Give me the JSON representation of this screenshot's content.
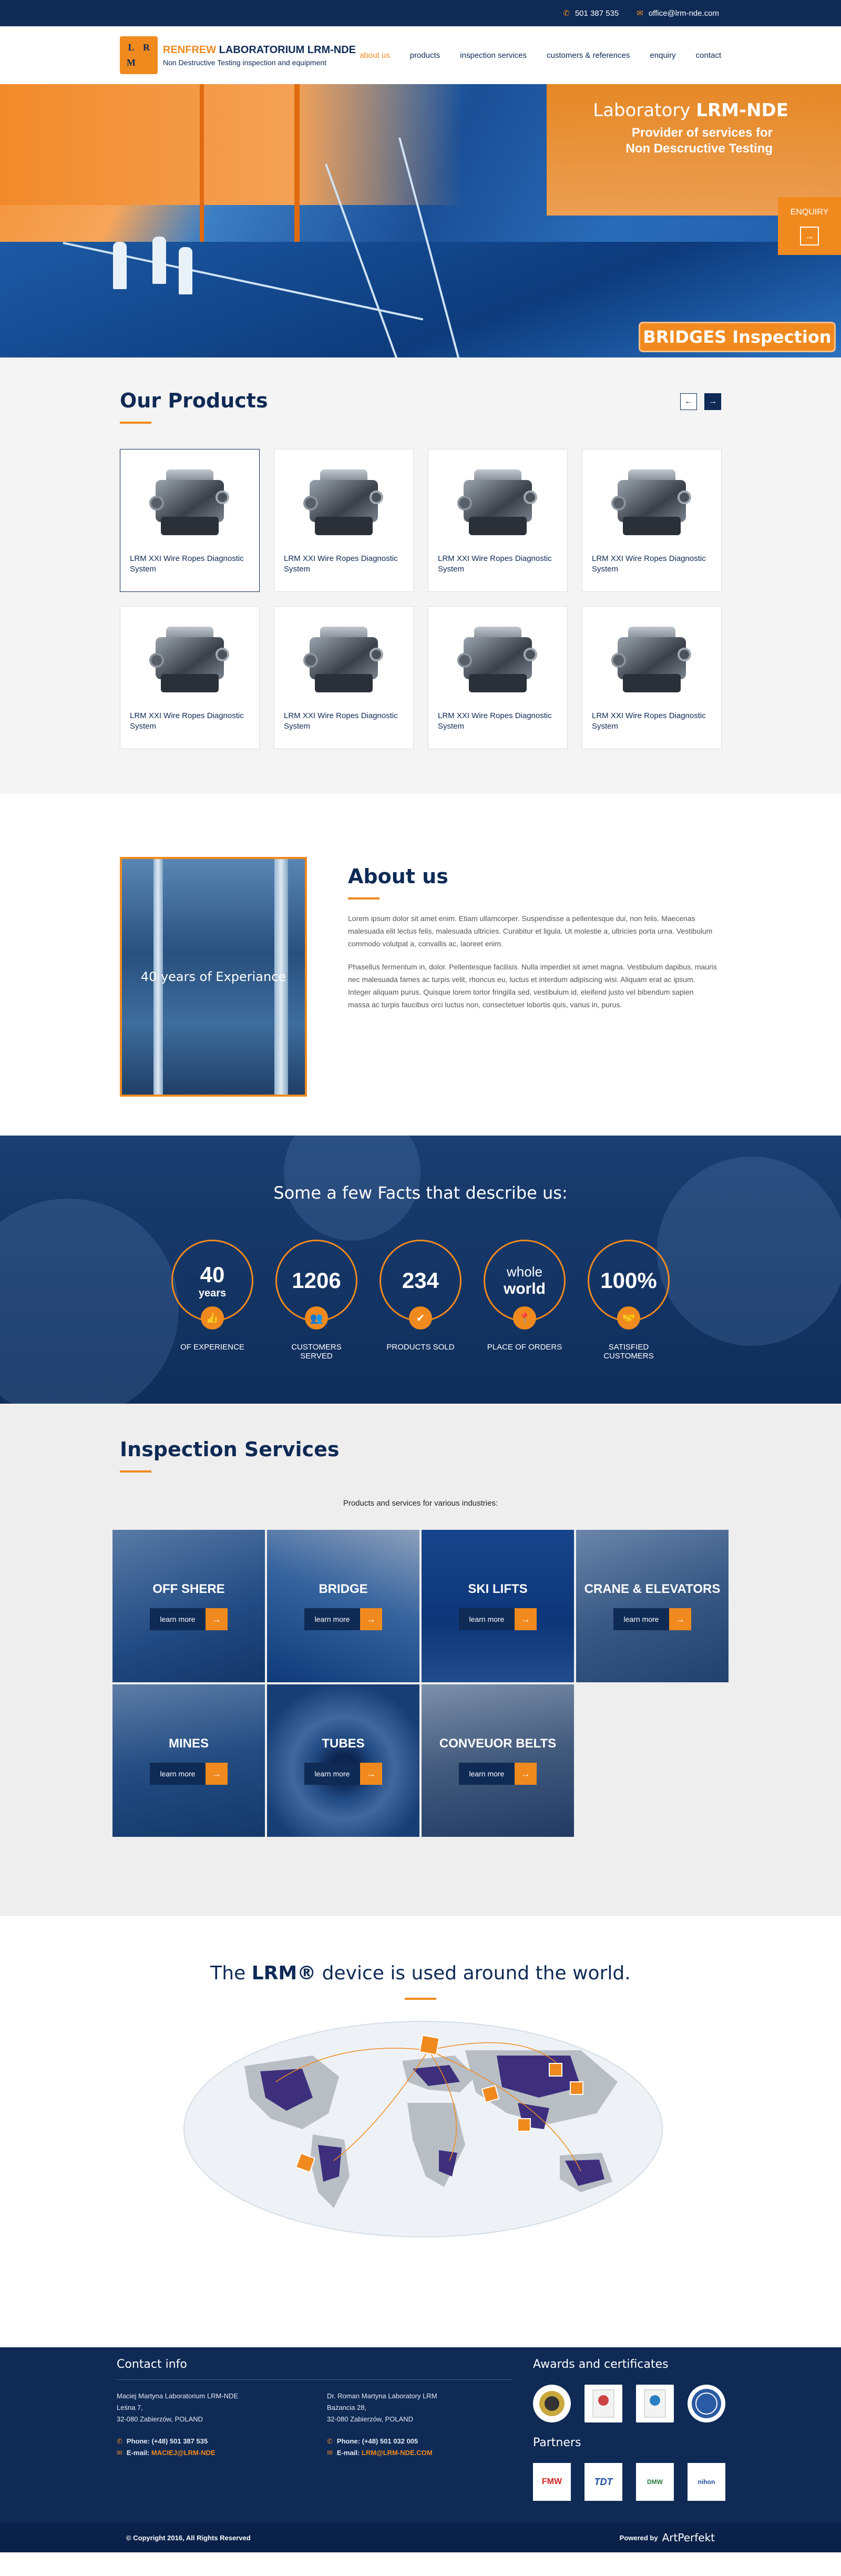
{
  "topbar": {
    "phone": "501 387 535",
    "email": "office@lrm-nde.com"
  },
  "header": {
    "logo_letters": [
      "L",
      "R",
      "M",
      ""
    ],
    "brand_orange": "RENFREW",
    "brand_dark": "LABORATORIUM LRM-NDE",
    "tagline": "Non Destructive Testing inspection and equipment",
    "nav": [
      "about us",
      "products",
      "inspection services",
      "customers & references",
      "enquiry",
      "contact"
    ],
    "active_nav": "about us"
  },
  "hero": {
    "title_prefix": "Laboratory",
    "title_bold": "LRM-NDE",
    "subtitle_line1": "Provider of services for",
    "subtitle_line2": "Non Descructive Testing",
    "enquiry_label": "ENQUIRY",
    "badge": "BRIDGES Inspection"
  },
  "products": {
    "title": "Our Products",
    "items": [
      "LRM XXI Wire Ropes Diagnostic System",
      "LRM XXI Wire Ropes Diagnostic System",
      "LRM XXI Wire Ropes Diagnostic System",
      "LRM XXI Wire Ropes Diagnostic System",
      "LRM XXI Wire Ropes Diagnostic System",
      "LRM XXI Wire Ropes Diagnostic System",
      "LRM XXI Wire Ropes Diagnostic System",
      "LRM XXI Wire Ropes Diagnostic System"
    ]
  },
  "about": {
    "title": "About us",
    "photo_caption": "40 years of Experiance",
    "p1": "Lorem ipsum dolor sit amet enim. Etiam ullamcorper. Suspendisse a pellentesque dui, non felis. Maecenas malesuada elit lectus felis, malesuada ultricies. Curabitur et ligula. Ut molestie a, ultricies porta urna. Vestibulum commodo volutpat a, convallis ac, laoreet enim.",
    "p2": "Phasellus fermentum in, dolor. Pellentesque facilisis. Nulla imperdiet sit amet magna. Vestibulum dapibus, mauris nec malesuada fames ac turpis velit, rhoncus eu, luctus et interdum adipiscing wisi. Aliquam erat ac ipsum. Integer aliquam purus. Quisque lorem tortor fringilla sed, vestibulum id, eleifend justo vel bibendum sapien massa ac turpis faucibus orci luctus non, consectetuer lobortis quis, varius in, purus."
  },
  "facts": {
    "title": "Some a few Facts that describe us:",
    "items": [
      {
        "top": "40",
        "bottom": "years",
        "label": "OF EXPERIENCE",
        "icon": "thumbs-up-icon",
        "glyph": "👍"
      },
      {
        "top": "1206",
        "bottom": "",
        "label": "CUSTOMERS SERVED",
        "icon": "users-icon",
        "glyph": "👥"
      },
      {
        "top": "234",
        "bottom": "",
        "label": "PRODUCTS SOLD",
        "icon": "check-badge-icon",
        "glyph": "✔"
      },
      {
        "top": "whole",
        "bottom": "world",
        "label": "PLACE OF ORDERS",
        "icon": "map-pin-icon",
        "glyph": "📍"
      },
      {
        "top": "100%",
        "bottom": "",
        "label": "SATISFIED CUSTOMERS",
        "icon": "handshake-icon",
        "glyph": "🤝"
      }
    ]
  },
  "inspection": {
    "title": "Inspection Services",
    "subtitle": "Products and services for various industries:",
    "learn_more": "learn more",
    "items": [
      "OFF SHERE",
      "BRIDGE",
      "SKI LIFTS",
      "CRANE & ELEVATORS",
      "MINES",
      "TUBES",
      "CONVEUOR BELTS"
    ]
  },
  "world": {
    "title_pre": "The",
    "title_bold": "LRM®",
    "title_post": "device is used around the world."
  },
  "footer": {
    "contact_title": "Contact info",
    "col1": {
      "name": "Maciej Martyna Laboratorium LRM-NDE",
      "street": "Leśna 7,",
      "city": "32-080 Zabierzów, POLAND",
      "phone": "Phone: (+48) 501 387 535",
      "email_label": "E-mail:",
      "email": "MACIEJ@LRM-NDE"
    },
    "col2": {
      "name": "Dr. Roman Martyna Laboratory LRM",
      "street": "Bażancia 28,",
      "city": "32-080 Zabierzów, POLAND",
      "phone": "Phone: (+48) 501 032 005",
      "email_label": "E-mail:",
      "email": "LRM@LRM-NDE.COM"
    },
    "awards_title": "Awards and certificates",
    "partners_title": "Partners",
    "partners": [
      "FMW",
      "TDT",
      "DMW",
      "nihon"
    ],
    "copyright": "© Copyright 2016, All Rights Reserved",
    "powered_by": "Powered by",
    "powered_brand": "ArtPerfekt"
  }
}
